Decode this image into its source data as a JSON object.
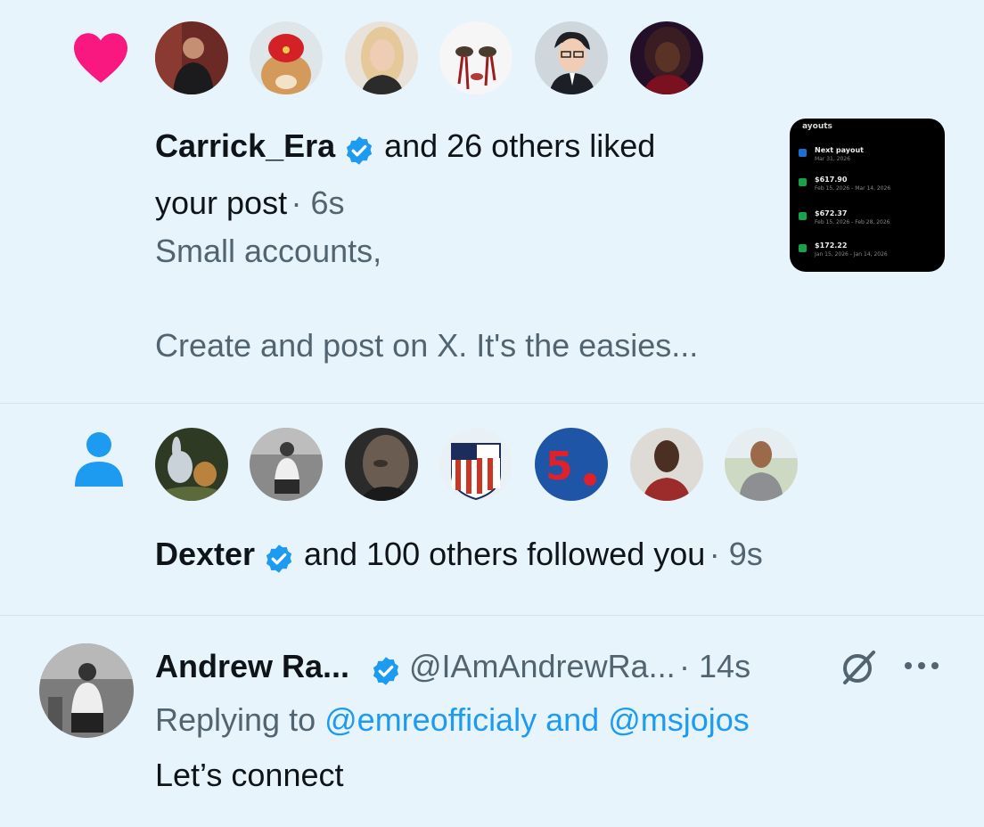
{
  "like_notification": {
    "icon": "heart-icon",
    "actor_name": "Carrick_Era",
    "summary": "and 26 others liked",
    "summary_line2": "your post",
    "time": "· 6s",
    "post_line1": "Small accounts,",
    "post_line2": "Create and post on X. It's the easies...",
    "thumbnail": {
      "header": "ayouts",
      "rows": [
        {
          "amount": "Next payout",
          "date": "Mar 31, 2026"
        },
        {
          "amount": "$617.90",
          "date": "Feb 15, 2026 - Mar 14, 2026"
        },
        {
          "amount": "$672.37",
          "date": "Feb 15, 2026 - Feb 28, 2026"
        },
        {
          "amount": "$172.22",
          "date": "Jan 15, 2026 - Jan 14, 2026"
        }
      ]
    }
  },
  "follow_notification": {
    "icon": "person-icon",
    "actor_name": "Dexter",
    "summary": "and 100 others followed you",
    "time": "· 9s"
  },
  "reply": {
    "author_name": "Andrew Ra...",
    "handle": "@IAmAndrewRa...",
    "time": "· 14s",
    "replying_prefix": "Replying to",
    "mention1": "@emreofficialy",
    "and_word": "and",
    "mention2": "@msjojos",
    "body": "Let’s connect"
  },
  "colors": {
    "background": "#e8f4fc",
    "heart": "#f91880",
    "follow_icon": "#1d9bf0",
    "verified": "#1d9bf0",
    "link": "#1d9bf0",
    "secondary_text": "#536471"
  }
}
